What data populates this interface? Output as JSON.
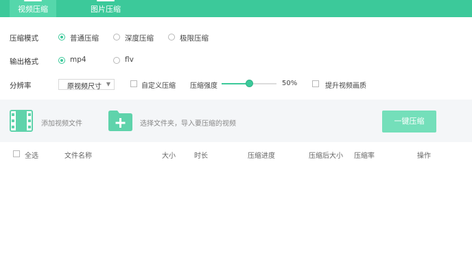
{
  "tabs": [
    {
      "label": "视频压缩",
      "active": true
    },
    {
      "label": "图片压缩",
      "active": false
    }
  ],
  "settings": {
    "mode_label": "压缩模式",
    "mode_options": [
      "普通压缩",
      "深度压缩",
      "极限压缩"
    ],
    "mode_selected": "普通压缩",
    "format_label": "输出格式",
    "format_options": [
      "mp4",
      "flv"
    ],
    "format_selected": "mp4",
    "resolution_label": "分辨率",
    "resolution_value": "原视频尺寸",
    "custom_label": "自定义压缩",
    "custom_checked": false,
    "strength_label": "压缩强度",
    "strength_value": "50%",
    "strength_fraction": 0.5,
    "enhance_label": "提升视频画质",
    "enhance_checked": false
  },
  "panel": {
    "add_video_label": "添加视频文件",
    "add_folder_label": "选择文件夹，导入要压缩的视频",
    "compress_button": "一键压缩"
  },
  "table": {
    "select_all": "全选",
    "columns": [
      "文件名称",
      "大小",
      "时长",
      "压缩进度",
      "压缩后大小",
      "压缩率",
      "操作"
    ],
    "rows": []
  },
  "colors": {
    "accent": "#3cc99a",
    "tab_active": "#55d7ab",
    "button_disabled": "#74dfba",
    "panel_bg": "#f4f6f8"
  },
  "icons": {
    "add_video": "film-icon",
    "add_folder": "folder-plus-icon",
    "dropdown": "chevron-down-icon"
  }
}
